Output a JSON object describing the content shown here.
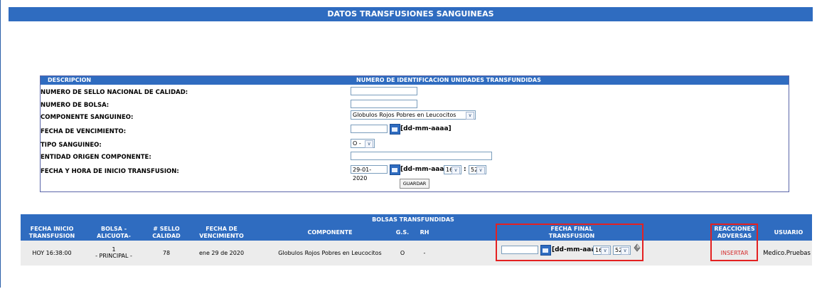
{
  "header": {
    "title": "DATOS TRANSFUSIONES SANGUINEAS"
  },
  "form": {
    "head_left": "DESCRIPCION",
    "head_right": "NUMERO DE IDENTIFICACION UNIDADES TRANSFUNDIDAS",
    "labels": {
      "sello": "NUMERO DE SELLO NACIONAL DE CALIDAD:",
      "bolsa": "NUMERO DE BOLSA:",
      "componente": "COMPONENTE SANGUINEO:",
      "vencimiento": "FECHA DE VENCIMIENTO:",
      "tipo": "TIPO SANGUINEO:",
      "entidad": "ENTIDAD ORIGEN COMPONENTE:",
      "inicio": "FECHA Y HORA DE INICIO TRANSFUSION:"
    },
    "values": {
      "sello": "",
      "bolsa": "",
      "componente": "Globulos Rojos Pobres en Leucocitos",
      "vencimiento": "",
      "tipo": "O -",
      "entidad": "",
      "inicio_fecha": "29-01-2020",
      "inicio_hora": "16",
      "inicio_min": "52"
    },
    "date_format": "[dd-mm-aaaa]",
    "separator": ":",
    "save_label": "GUARDAR"
  },
  "table": {
    "title": "BOLSAS TRANSFUNDIDAS",
    "headers": {
      "fecha_inicio": "FECHA INICIO TRANSFUSION",
      "bolsa": "BOLSA -ALICUOTA-",
      "sello": "# SELLO CALIDAD",
      "vencimiento": "FECHA DE VENCIMIENTO",
      "componente": "COMPONENTE",
      "gs": "G.S.",
      "rh": "RH",
      "fecha_final": "FECHA FINAL TRANSFUSION",
      "reacciones": "REACCIONES ADVERSAS",
      "usuario": "USUARIO"
    },
    "row": {
      "fecha_inicio": "HOY 16:38:00",
      "bolsa_num": "1",
      "bolsa_tipo": "- PRINCIPAL -",
      "sello": "78",
      "vencimiento": "ene 29 de 2020",
      "componente": "Globulos Rojos Pobres en Leucocitos",
      "gs": "O",
      "rh": "-",
      "fecha_final": "",
      "date_format": "[dd-mm-aaaa]",
      "hora": "16",
      "min": "52",
      "reacciones_link": "INSERTAR",
      "usuario": "Medico.Pruebas"
    }
  },
  "colors": {
    "header_blue": "#2f6cc0",
    "highlight_red": "#e42121",
    "link_red": "#d42c2c"
  }
}
